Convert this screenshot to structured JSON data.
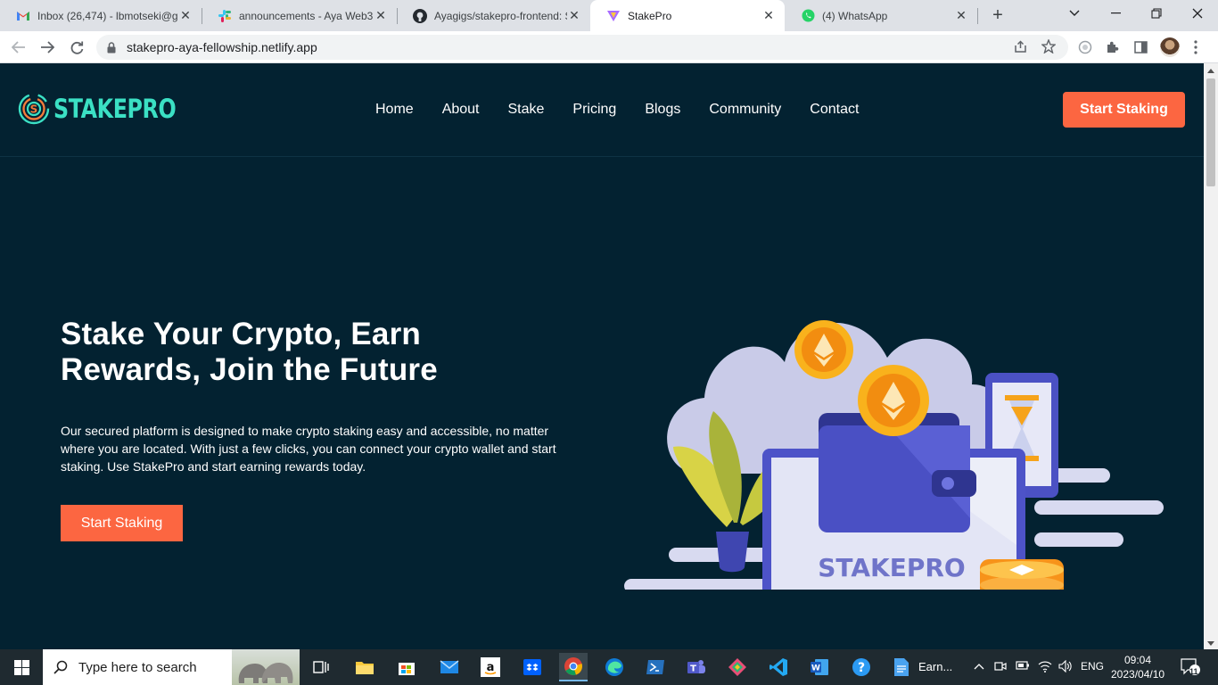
{
  "browser": {
    "tabs": [
      {
        "title": "Inbox (26,474) - lbmotseki@g",
        "icon": "gmail-icon"
      },
      {
        "title": "announcements - Aya Web3",
        "icon": "slack-icon"
      },
      {
        "title": "Ayagigs/stakepro-frontend: S",
        "icon": "github-icon"
      },
      {
        "title": "StakePro",
        "icon": "stakepro-icon"
      },
      {
        "title": "(4) WhatsApp",
        "icon": "whatsapp-icon"
      }
    ],
    "url": "stakepro-aya-fellowship.netlify.app"
  },
  "site": {
    "logo_text": "STAKEPRO",
    "nav": [
      "Home",
      "About",
      "Stake",
      "Pricing",
      "Blogs",
      "Community",
      "Contact"
    ],
    "header_cta": "Start Staking",
    "hero_title": "Stake Your Crypto, Earn Rewards, Join the Future",
    "hero_text": "Our secured platform is designed to make crypto staking easy and accessible, no matter where you are located. With just a few clicks, you can connect your crypto wallet and start staking. Use StakePro and start earning rewards today.",
    "hero_cta": "Start Staking",
    "illustration_label": "STAKEPRO",
    "colors": {
      "background": "#032231",
      "accent": "#fc6641",
      "logo": "#3be0c4"
    }
  },
  "taskbar": {
    "search_placeholder": "Type here to search",
    "open_window_label": "Earn...",
    "language": "ENG",
    "time": "09:04",
    "date": "2023/04/10",
    "notification_count": "11"
  }
}
